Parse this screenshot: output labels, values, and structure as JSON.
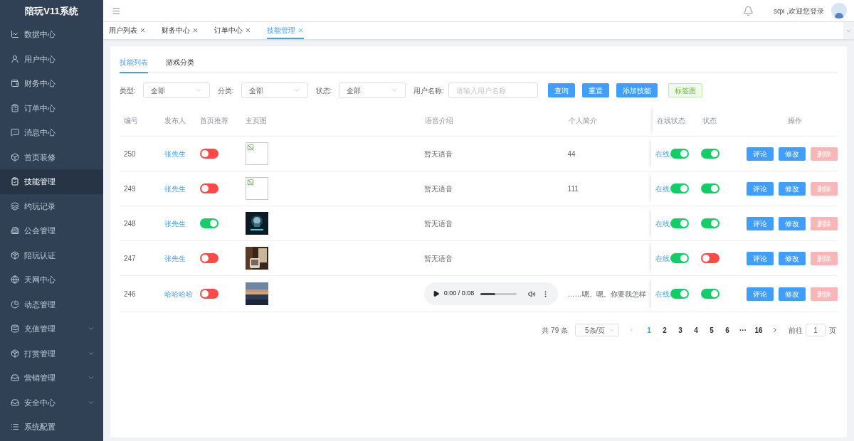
{
  "sidebar": {
    "title": "陪玩V11系统",
    "items": [
      {
        "label": "数据中心",
        "selected": false,
        "kind": "link"
      },
      {
        "label": "用户中心",
        "selected": false,
        "kind": "link"
      },
      {
        "label": "财务中心",
        "selected": false,
        "kind": "link"
      },
      {
        "label": "订单中心",
        "selected": false,
        "kind": "link"
      },
      {
        "label": "消息中心",
        "selected": false,
        "kind": "link"
      },
      {
        "label": "首页装修",
        "selected": false,
        "kind": "link"
      },
      {
        "label": "技能管理",
        "selected": true,
        "kind": "link"
      },
      {
        "label": "约玩记录",
        "selected": false,
        "kind": "link"
      },
      {
        "label": "公会管理",
        "selected": false,
        "kind": "link"
      },
      {
        "label": "陪玩认证",
        "selected": false,
        "kind": "link"
      },
      {
        "label": "天网中心",
        "selected": false,
        "kind": "link"
      },
      {
        "label": "动态管理",
        "selected": false,
        "kind": "link"
      },
      {
        "label": "充值管理",
        "selected": false,
        "kind": "submenu"
      },
      {
        "label": "打赏管理",
        "selected": false,
        "kind": "submenu"
      },
      {
        "label": "营销管理",
        "selected": false,
        "kind": "submenu"
      },
      {
        "label": "安全中心",
        "selected": false,
        "kind": "submenu"
      },
      {
        "label": "系统配置",
        "selected": false,
        "kind": "link"
      }
    ]
  },
  "header": {
    "user": "sqx ,欢迎您登录"
  },
  "tabs": [
    {
      "label": "用户列表",
      "selected": false
    },
    {
      "label": "财务中心",
      "selected": false
    },
    {
      "label": "订单中心",
      "selected": false
    },
    {
      "label": "技能管理",
      "selected": true
    }
  ],
  "inner_tabs": [
    {
      "label": "技能列表",
      "selected": true
    },
    {
      "label": "游戏分类",
      "selected": false
    }
  ],
  "filters": {
    "selects": [
      {
        "label": "类型:",
        "value": "全部"
      },
      {
        "label": "分类:",
        "value": "全部"
      },
      {
        "label": "状态:",
        "value": "全部"
      }
    ],
    "search": {
      "label": "用户名称:",
      "placeholder": "请输入用户名称"
    },
    "buttons": [
      {
        "label": "查询",
        "kind": "primary"
      },
      {
        "label": "重置",
        "kind": "primary"
      },
      {
        "label": "添加技能",
        "kind": "primary"
      },
      {
        "label": "标签图",
        "kind": "success"
      }
    ]
  },
  "table": {
    "columns": [
      "编号",
      "发布人",
      "首页推荐",
      "主页图",
      "语音介绍",
      "个人简介",
      "在线状态",
      "状态",
      "操作"
    ],
    "rows": [
      {
        "id": "250",
        "publisher": "张先生",
        "recommended": false,
        "image": {
          "kind": "broken"
        },
        "voice": {
          "kind": "text",
          "text": "暂无语音"
        },
        "bio": "44",
        "online": {
          "label": "在线",
          "on": true
        },
        "status_on": true,
        "actions": [
          {
            "label": "评论",
            "kind": "primary",
            "disabled": false
          },
          {
            "label": "修改",
            "kind": "primary",
            "disabled": false
          },
          {
            "label": "删除",
            "kind": "danger",
            "disabled": true
          }
        ]
      },
      {
        "id": "249",
        "publisher": "张先生",
        "recommended": false,
        "image": {
          "kind": "broken"
        },
        "voice": {
          "kind": "text",
          "text": "暂无语音"
        },
        "bio": "111",
        "online": {
          "label": "在线",
          "on": true
        },
        "status_on": true,
        "actions": [
          {
            "label": "评论",
            "kind": "primary",
            "disabled": false
          },
          {
            "label": "修改",
            "kind": "primary",
            "disabled": false
          },
          {
            "label": "删除",
            "kind": "danger",
            "disabled": true
          }
        ]
      },
      {
        "id": "248",
        "publisher": "张先生",
        "recommended": true,
        "image": {
          "kind": "picture"
        },
        "voice": {
          "kind": "text",
          "text": "暂无语音"
        },
        "online": {
          "label": "在线",
          "on": true
        },
        "status_on": true,
        "actions": [
          {
            "label": "评论",
            "kind": "primary",
            "disabled": false
          },
          {
            "label": "修改",
            "kind": "primary",
            "disabled": false
          },
          {
            "label": "删除",
            "kind": "danger",
            "disabled": true
          }
        ]
      },
      {
        "id": "247",
        "publisher": "张先生",
        "recommended": false,
        "image": {
          "kind": "picture"
        },
        "voice": {
          "kind": "text",
          "text": "暂无语音"
        },
        "online": {
          "label": "在线",
          "on": true
        },
        "status_on": false,
        "actions": [
          {
            "label": "评论",
            "kind": "primary",
            "disabled": false
          },
          {
            "label": "修改",
            "kind": "primary",
            "disabled": false
          },
          {
            "label": "删除",
            "kind": "danger",
            "disabled": true
          }
        ]
      },
      {
        "id": "246",
        "publisher": "哈哈哈哈",
        "recommended": false,
        "image": {
          "kind": "picture"
        },
        "voice": {
          "kind": "audio",
          "time": "0:00 / 0:08",
          "level": 0.4
        },
        "bio": "……嗯。嗯。你要我怎样",
        "online": {
          "label": "在线",
          "on": true
        },
        "status_on": true,
        "actions": [
          {
            "label": "评论",
            "kind": "primary",
            "disabled": false
          },
          {
            "label": "修改",
            "kind": "primary",
            "disabled": false
          },
          {
            "label": "删除",
            "kind": "danger",
            "disabled": true
          }
        ]
      }
    ]
  },
  "pagination": {
    "total": "共 79 条",
    "page_size": "5条/页",
    "pages": [
      {
        "label": "1",
        "selected": true
      },
      {
        "label": "2",
        "selected": false
      },
      {
        "label": "3",
        "selected": false
      },
      {
        "label": "4",
        "selected": false
      },
      {
        "label": "5",
        "selected": false
      },
      {
        "label": "6",
        "selected": false
      },
      {
        "label": "···",
        "selected": false
      },
      {
        "label": "16",
        "selected": false
      }
    ],
    "goto_label": "前往",
    "goto_value": "1",
    "goto_suffix": "页"
  }
}
